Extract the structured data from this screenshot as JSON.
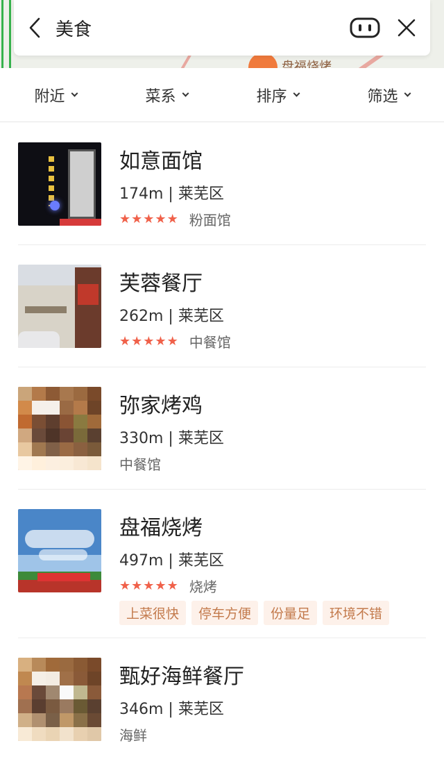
{
  "search": {
    "query": "美食"
  },
  "map": {
    "poi_label": "盘福烧烤"
  },
  "filters": [
    {
      "label": "附近"
    },
    {
      "label": "菜系"
    },
    {
      "label": "排序"
    },
    {
      "label": "筛选"
    }
  ],
  "results": [
    {
      "name": "如意面馆",
      "distance": "174m | 莱芜区",
      "rating": 5,
      "category": "粉面馆",
      "thumb": "night-storefront"
    },
    {
      "name": "芙蓉餐厅",
      "distance": "262m | 莱芜区",
      "rating": 5,
      "category": "中餐馆",
      "thumb": "shop-building"
    },
    {
      "name": "弥家烤鸡",
      "distance": "330m | 莱芜区",
      "rating": null,
      "category": "中餐馆",
      "thumb": "placeholder-mosaic"
    },
    {
      "name": "盘福烧烤",
      "distance": "497m | 莱芜区",
      "rating": 5,
      "category": "烧烤",
      "thumb": "sky-storefront",
      "tags": [
        "上菜很快",
        "停车方便",
        "份量足",
        "环境不错"
      ]
    },
    {
      "name": "甄好海鲜餐厅",
      "distance": "346m | 莱芜区",
      "rating": null,
      "category": "海鲜",
      "thumb": "placeholder-mosaic"
    }
  ],
  "colors": {
    "star": "#f0614a",
    "tag_bg": "#fdf1ea",
    "tag_text": "#c37a4c",
    "map_road": "#37b24d"
  }
}
